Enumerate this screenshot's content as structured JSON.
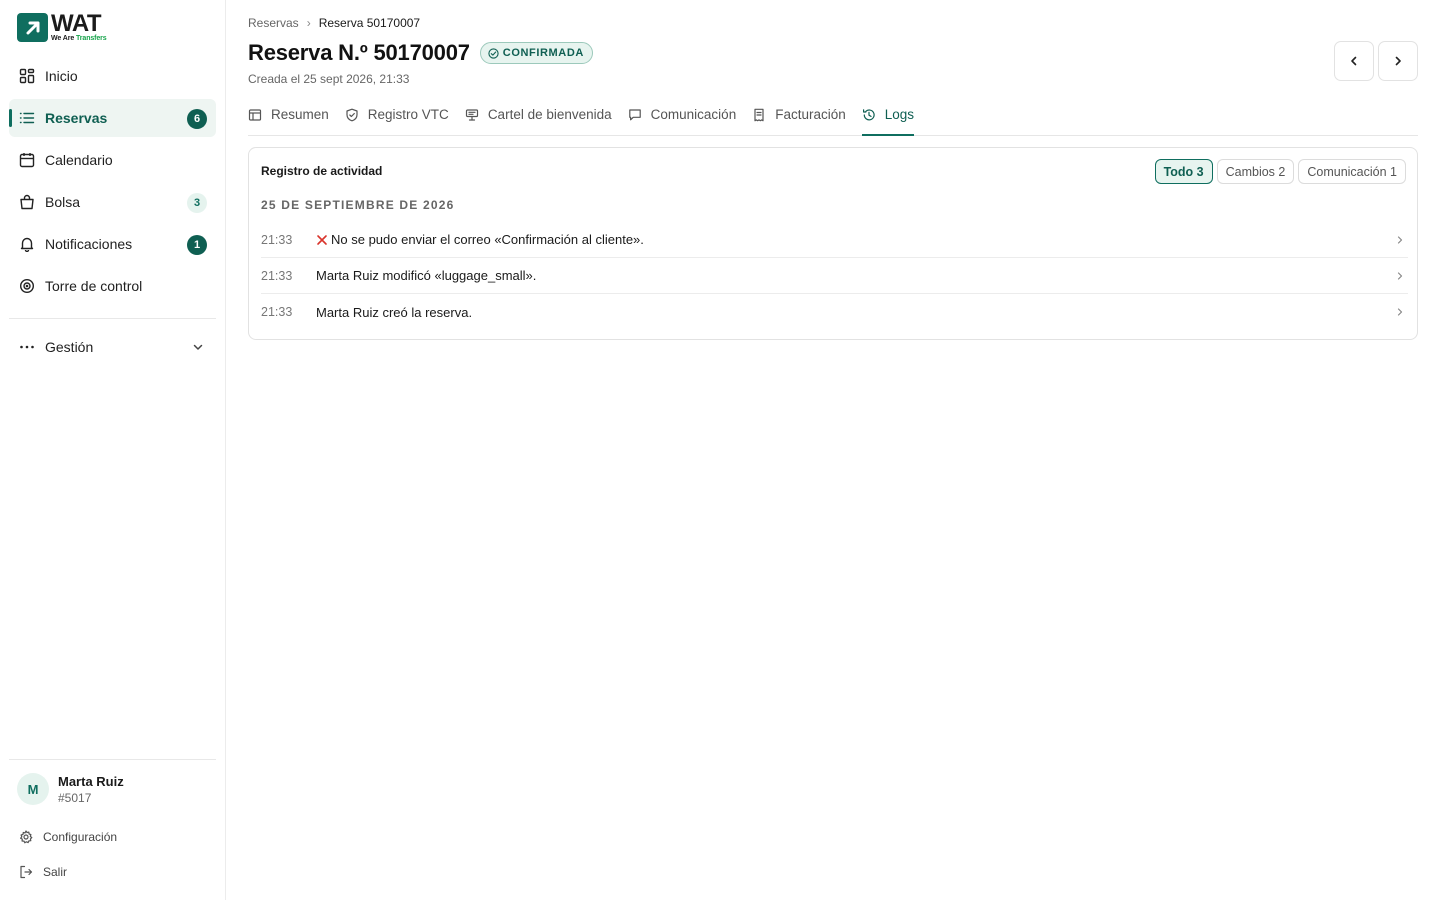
{
  "brand": {
    "word": "WAT",
    "tagline_a": "We Are ",
    "tagline_b": "Transfers",
    "accent": "#0f6e5f"
  },
  "sidebar": {
    "items": [
      {
        "label": "Inicio",
        "icon": "grid-icon"
      },
      {
        "label": "Reservas",
        "icon": "list-icon",
        "badge": "6",
        "active": true
      },
      {
        "label": "Calendario",
        "icon": "calendar-icon"
      },
      {
        "label": "Bolsa",
        "icon": "bag-icon",
        "badge": "3"
      },
      {
        "label": "Notificaciones",
        "icon": "bell-icon",
        "badge": "1"
      },
      {
        "label": "Torre de control",
        "icon": "target-icon"
      }
    ],
    "gestion": "Gestión",
    "user": {
      "initial": "M",
      "name": "Marta Ruiz",
      "id": "#5017"
    },
    "settings": "Configuración",
    "logout": "Salir"
  },
  "breadcrumb": {
    "parent": "Reservas",
    "current": "Reserva 50170007"
  },
  "header": {
    "title": "Reserva N.º 50170007",
    "status": "CONFIRMADA",
    "created": "Creada el 25 sept 2026, 21:33"
  },
  "tabs": [
    {
      "label": "Resumen",
      "icon": "table-icon"
    },
    {
      "label": "Registro VTC",
      "icon": "shield-icon"
    },
    {
      "label": "Cartel de bienvenida",
      "icon": "sign-icon"
    },
    {
      "label": "Comunicación",
      "icon": "chat-icon"
    },
    {
      "label": "Facturación",
      "icon": "receipt-icon"
    },
    {
      "label": "Logs",
      "icon": "history-icon",
      "active": true
    }
  ],
  "activity": {
    "title": "Registro de actividad",
    "filters": [
      {
        "label": "Todo 3",
        "active": true
      },
      {
        "label": "Cambios 2"
      },
      {
        "label": "Comunicación 1"
      }
    ],
    "date": "25 DE SEPTIEMBRE DE 2026",
    "entries": [
      {
        "time": "21:33",
        "text": "No se pudo enviar el correo «Confirmación al cliente».",
        "error": true
      },
      {
        "time": "21:33",
        "text": "Marta Ruiz modificó «luggage_small»."
      },
      {
        "time": "21:33",
        "text": "Marta Ruiz creó la reserva."
      }
    ]
  }
}
